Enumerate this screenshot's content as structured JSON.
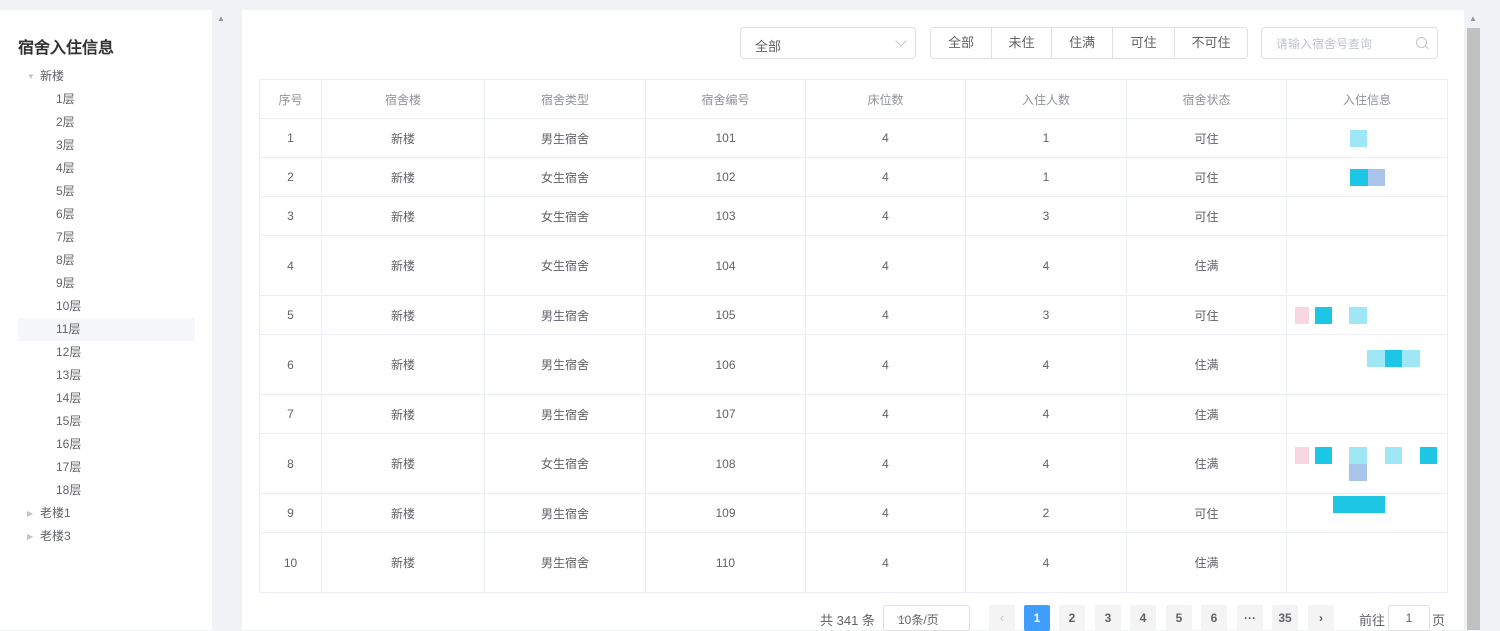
{
  "sidebar": {
    "title": "宿舍入住信息",
    "tree": [
      {
        "label": "新楼",
        "expanded": true,
        "children": [
          "1层",
          "2层",
          "3层",
          "4层",
          "5层",
          "6层",
          "7层",
          "8层",
          "9层",
          "10层",
          "11层",
          "12层",
          "13层",
          "14层",
          "15层",
          "16层",
          "17层",
          "18层"
        ],
        "selected_child": "11层"
      },
      {
        "label": "老楼1",
        "expanded": false
      },
      {
        "label": "老楼3",
        "expanded": false
      }
    ]
  },
  "toolbar": {
    "status_select": {
      "value": "全部"
    },
    "filter_buttons": [
      "全部",
      "未住",
      "住满",
      "可住",
      "不可住"
    ],
    "search": {
      "placeholder": "请输入宿舍号查询"
    }
  },
  "table": {
    "columns": [
      "序号",
      "宿舍楼",
      "宿舍类型",
      "宿舍编号",
      "床位数",
      "入住人数",
      "宿舍状态",
      "入住信息"
    ],
    "rows": [
      [
        "1",
        "新楼",
        "男生宿舍",
        "101",
        "4",
        "1",
        "可住"
      ],
      [
        "2",
        "新楼",
        "女生宿舍",
        "102",
        "4",
        "1",
        "可住"
      ],
      [
        "3",
        "新楼",
        "女生宿舍",
        "103",
        "4",
        "3",
        "可住"
      ],
      [
        "4",
        "新楼",
        "女生宿舍",
        "104",
        "4",
        "4",
        "住满"
      ],
      [
        "5",
        "新楼",
        "男生宿舍",
        "105",
        "4",
        "3",
        "可住"
      ],
      [
        "6",
        "新楼",
        "男生宿舍",
        "106",
        "4",
        "4",
        "住满"
      ],
      [
        "7",
        "新楼",
        "男生宿舍",
        "107",
        "4",
        "4",
        "住满"
      ],
      [
        "8",
        "新楼",
        "女生宿舍",
        "108",
        "4",
        "4",
        "住满"
      ],
      [
        "9",
        "新楼",
        "男生宿舍",
        "109",
        "4",
        "2",
        "可住"
      ],
      [
        "10",
        "新楼",
        "男生宿舍",
        "110",
        "4",
        "4",
        "住满"
      ]
    ]
  },
  "pagination": {
    "total_text": "共 341 条",
    "page_size": "10条/页",
    "pages": [
      "1",
      "2",
      "3",
      "4",
      "5",
      "6"
    ],
    "ellipsis": "···",
    "last_page": "35",
    "current_page": "1",
    "goto_prefix": "前往",
    "goto_value": "1",
    "goto_suffix": "页",
    "prev_icon": "‹",
    "next_icon": "›"
  },
  "colors": {
    "accent": "#409eff",
    "cyan": "#1ec6e6",
    "light_cyan": "#9fe6f7",
    "pink": "#f8d7e3",
    "lavender": "#a9c4ea"
  }
}
